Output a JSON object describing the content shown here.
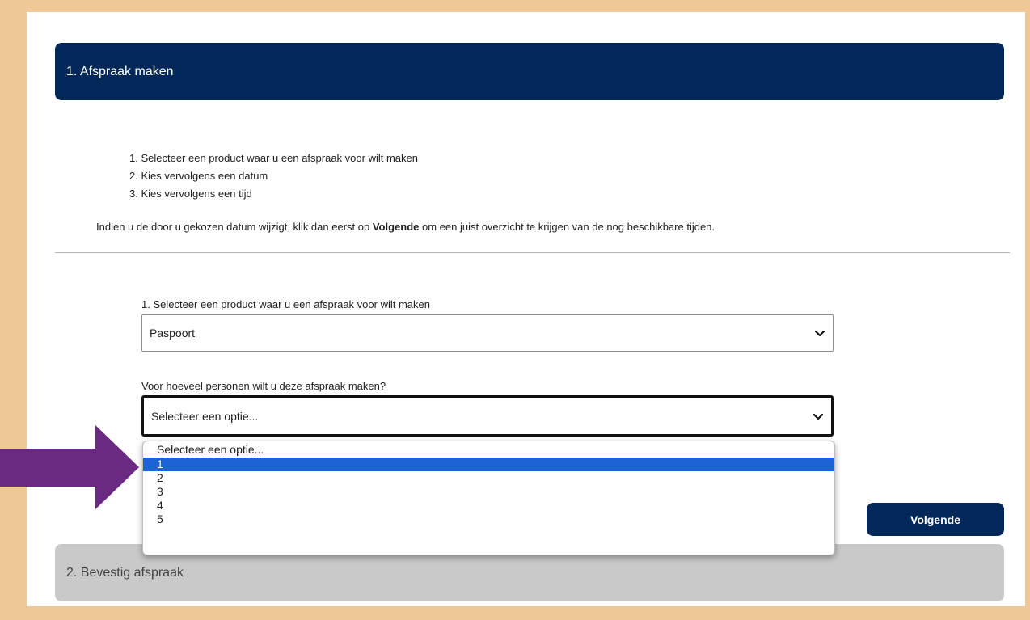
{
  "section1": {
    "title": "1. Afspraak maken"
  },
  "steps": [
    "1. Selecteer een product waar u een afspraak voor wilt maken",
    "2. Kies vervolgens een datum",
    "3. Kies vervolgens een tijd"
  ],
  "intro": {
    "before": "Indien u de door u gekozen datum wijzigt, klik dan eerst op ",
    "bold": "Volgende",
    "after": " om een juist overzicht te krijgen van de nog beschikbare tijden."
  },
  "product_field": {
    "label": "1. Selecteer een product waar u een afspraak voor wilt maken",
    "value": "Paspoort"
  },
  "persons_field": {
    "label": "Voor hoeveel personen wilt u deze afspraak maken?",
    "value": "Selecteer een optie...",
    "options": [
      "Selecteer een optie...",
      "1",
      "2",
      "3",
      "4",
      "5"
    ],
    "highlighted": "1"
  },
  "next_button": {
    "label": "Volgende"
  },
  "section2": {
    "title": "2. Bevestig afspraak"
  },
  "colors": {
    "frame": "#efc897",
    "header": "#02285a",
    "highlight": "#1e63d6",
    "arrow": "#6b2a82"
  },
  "icons": {
    "select_chevron": "chevron-down-icon",
    "pointer": "arrow-right-icon"
  }
}
